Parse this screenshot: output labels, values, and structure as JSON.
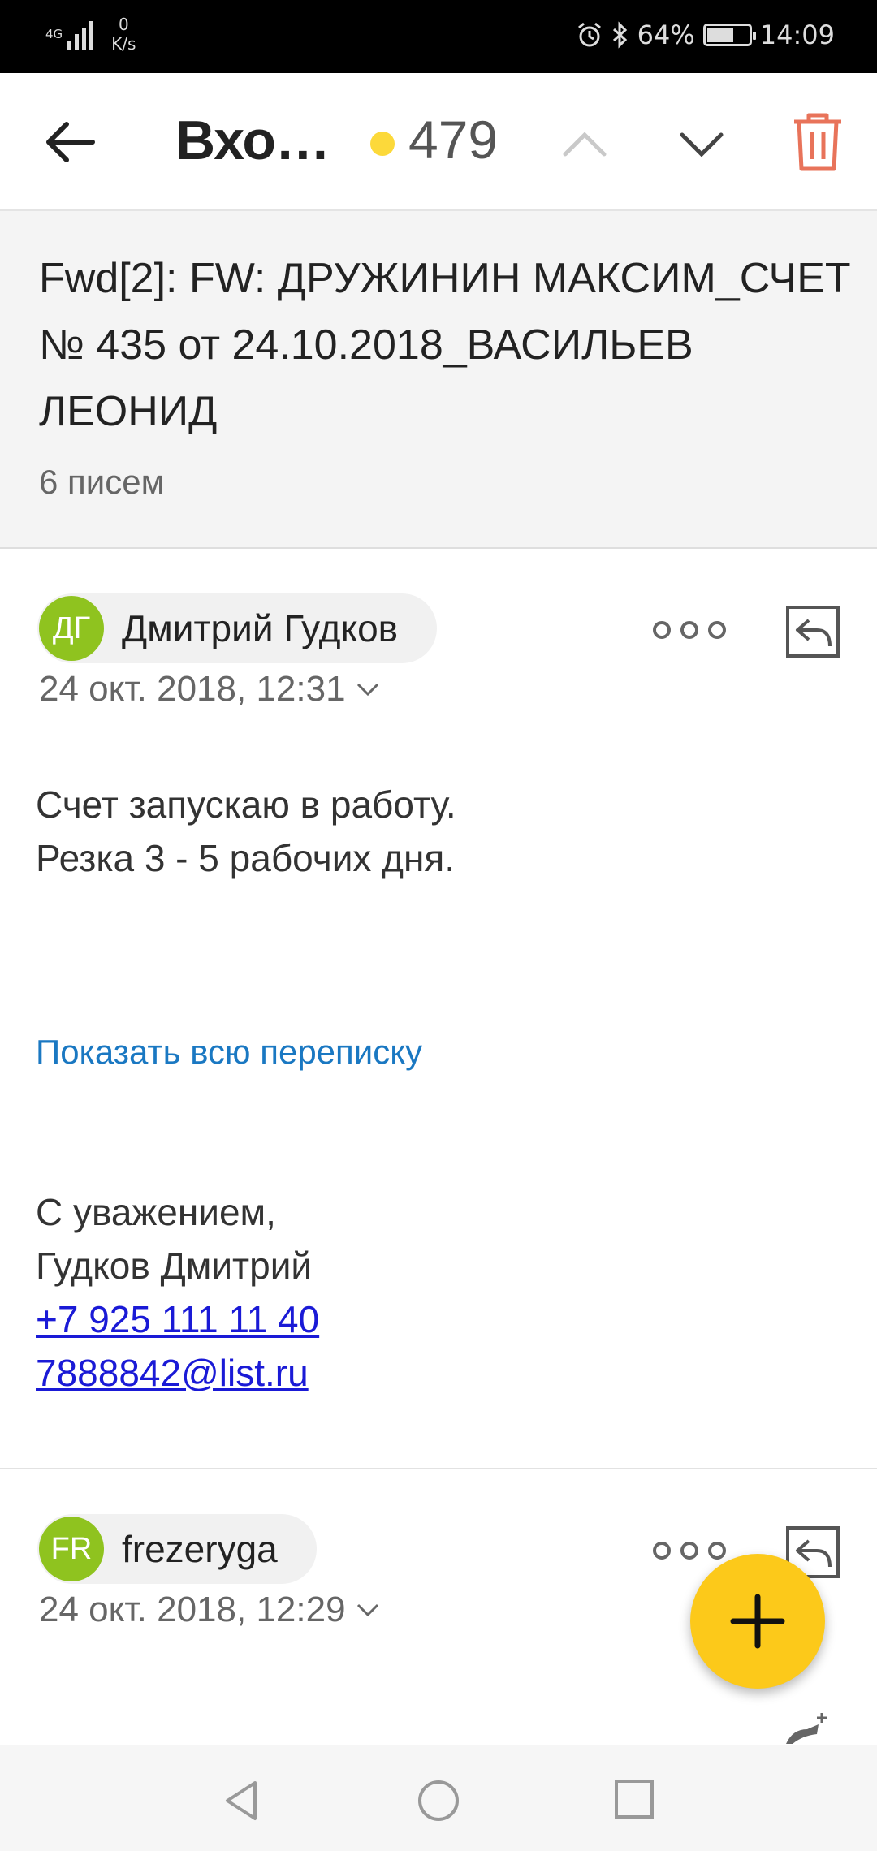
{
  "status_bar": {
    "network": "4G",
    "speed_value": "0",
    "speed_unit": "K/s",
    "battery": "64%",
    "battery_level": 0.64,
    "time": "14:09",
    "icons": [
      "signal-icon",
      "alarm-icon",
      "bluetooth-icon",
      "battery-icon"
    ]
  },
  "toolbar": {
    "title": "Вхо…",
    "unread_count": "479",
    "unread_dot_color": "#fcd93a",
    "trash_color": "#e8735a"
  },
  "thread": {
    "subject": "Fwd[2]: FW: ДРУЖИНИН МАКСИМ_СЧЕТ № 435 от 24.10.2018_ВАСИЛЬЕВ ЛЕОНИД",
    "message_count": "6 писем"
  },
  "messages": [
    {
      "avatar_initials": "ДГ",
      "sender": "Дмитрий Гудков",
      "date": "24 окт. 2018, 12:31",
      "body_lines": [
        "Счет запускаю в работу.",
        "Резка 3 - 5 рабочих дня."
      ],
      "show_all_link": "Показать всю переписку",
      "signature": {
        "greeting": "С уважением,",
        "name": "Гудков Дмитрий",
        "phone": "+7 925 111 11 40",
        "email": "7888842@list.ru"
      }
    },
    {
      "avatar_initials": "FR",
      "sender": "frezeryga",
      "date": "24 окт. 2018, 12:29"
    }
  ],
  "colors": {
    "avatar": "#8fc31f",
    "fab": "#fcc91a",
    "link": "#1a78c2"
  }
}
